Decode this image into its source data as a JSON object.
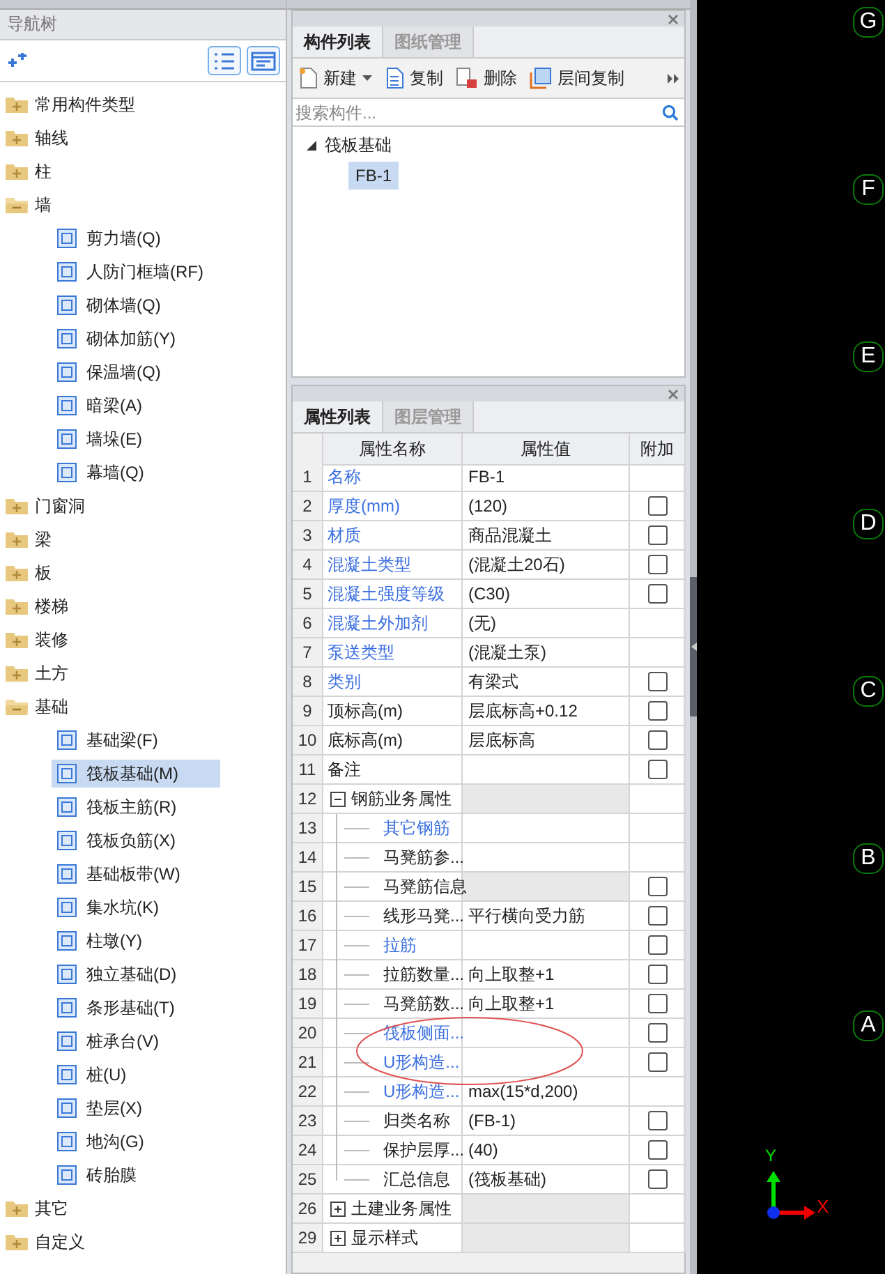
{
  "nav": {
    "title": "导航树",
    "tree": [
      {
        "label": "常用构件类型",
        "expanded": false
      },
      {
        "label": "轴线",
        "expanded": false
      },
      {
        "label": "柱",
        "expanded": false
      },
      {
        "label": "墙",
        "expanded": true,
        "children": [
          {
            "label": "剪力墙(Q)",
            "selected": false
          },
          {
            "label": "人防门框墙(RF)",
            "selected": false
          },
          {
            "label": "砌体墙(Q)",
            "selected": false
          },
          {
            "label": "砌体加筋(Y)",
            "selected": false
          },
          {
            "label": "保温墙(Q)",
            "selected": false
          },
          {
            "label": "暗梁(A)",
            "selected": false
          },
          {
            "label": "墙垛(E)",
            "selected": false
          },
          {
            "label": "幕墙(Q)",
            "selected": false
          }
        ]
      },
      {
        "label": "门窗洞",
        "expanded": false
      },
      {
        "label": "梁",
        "expanded": false
      },
      {
        "label": "板",
        "expanded": false
      },
      {
        "label": "楼梯",
        "expanded": false
      },
      {
        "label": "装修",
        "expanded": false
      },
      {
        "label": "土方",
        "expanded": false
      },
      {
        "label": "基础",
        "expanded": true,
        "children": [
          {
            "label": "基础梁(F)",
            "selected": false
          },
          {
            "label": "筏板基础(M)",
            "selected": true
          },
          {
            "label": "筏板主筋(R)",
            "selected": false
          },
          {
            "label": "筏板负筋(X)",
            "selected": false
          },
          {
            "label": "基础板带(W)",
            "selected": false
          },
          {
            "label": "集水坑(K)",
            "selected": false
          },
          {
            "label": "柱墩(Y)",
            "selected": false
          },
          {
            "label": "独立基础(D)",
            "selected": false
          },
          {
            "label": "条形基础(T)",
            "selected": false
          },
          {
            "label": "桩承台(V)",
            "selected": false
          },
          {
            "label": "桩(U)",
            "selected": false
          },
          {
            "label": "垫层(X)",
            "selected": false
          },
          {
            "label": "地沟(G)",
            "selected": false
          },
          {
            "label": "砖胎膜",
            "selected": false
          }
        ]
      },
      {
        "label": "其它",
        "expanded": false
      },
      {
        "label": "自定义",
        "expanded": false
      }
    ]
  },
  "component_panel": {
    "tabs": [
      {
        "label": "构件列表",
        "selected": true
      },
      {
        "label": "图纸管理",
        "selected": false
      }
    ],
    "toolbar": [
      {
        "label": "新建",
        "kind": "new"
      },
      {
        "label": "复制",
        "kind": "copy"
      },
      {
        "label": "删除",
        "kind": "delete"
      },
      {
        "label": "层间复制",
        "kind": "floorcopy"
      }
    ],
    "search": {
      "placeholder": "搜索构件..."
    },
    "tree": [
      {
        "label": "筏板基础",
        "expanded": true,
        "children": [
          {
            "label": "FB-1",
            "selected": true
          }
        ]
      }
    ]
  },
  "property_panel": {
    "tabs": [
      {
        "label": "属性列表",
        "selected": true
      },
      {
        "label": "图层管理",
        "selected": false
      }
    ],
    "columns": [
      "属性名称",
      "属性值",
      "附加"
    ],
    "rows": [
      {
        "num": "1",
        "name": "名称",
        "value": "FB-1",
        "public": true
      },
      {
        "num": "2",
        "name": "厚度(mm)",
        "value": "(120)",
        "public": true,
        "checked": false
      },
      {
        "num": "3",
        "name": "材质",
        "value": "商品混凝土",
        "public": true,
        "checked": false
      },
      {
        "num": "4",
        "name": "混凝土类型",
        "value": "(混凝土20石)",
        "public": true,
        "checked": false
      },
      {
        "num": "5",
        "name": "混凝土强度等级",
        "value": "(C30)",
        "public": true,
        "checked": false
      },
      {
        "num": "6",
        "name": "混凝土外加剂",
        "value": "(无)",
        "public": true
      },
      {
        "num": "7",
        "name": "泵送类型",
        "value": "(混凝土泵)",
        "public": true
      },
      {
        "num": "8",
        "name": "类别",
        "value": "有梁式",
        "public": true,
        "checked": false
      },
      {
        "num": "9",
        "name": "顶标高(m)",
        "value": "层底标高+0.12",
        "public": false,
        "checked": false
      },
      {
        "num": "10",
        "name": "底标高(m)",
        "value": "层底标高",
        "public": false,
        "checked": false
      },
      {
        "num": "11",
        "name": "备注",
        "public": false,
        "checked": false
      },
      {
        "num": "12",
        "name": "钢筋业务属性",
        "kind": "group",
        "expanded": true,
        "children": [
          {
            "num": "13",
            "name": "其它钢筋",
            "public": true
          },
          {
            "num": "14",
            "name": "马凳筋参...",
            "public": false
          },
          {
            "num": "15",
            "name": "马凳筋信息",
            "public": false,
            "value_disabled": true,
            "checked": false
          },
          {
            "num": "16",
            "name": "线形马凳...",
            "value": "平行横向受力筋",
            "public": false,
            "checked": false
          },
          {
            "num": "17",
            "name": "拉筋",
            "public": true,
            "checked": false
          },
          {
            "num": "18",
            "name": "拉筋数量...",
            "value": "向上取整+1",
            "public": false,
            "checked": false
          },
          {
            "num": "19",
            "name": "马凳筋数...",
            "value": "向上取整+1",
            "public": false,
            "checked": false
          },
          {
            "num": "20",
            "name": "筏板侧面...",
            "public": true,
            "checked": false
          },
          {
            "num": "21",
            "name": "U形构造...",
            "public": true,
            "checked": false
          },
          {
            "num": "22",
            "name": "U形构造...",
            "value": "max(15*d,200)",
            "public": true
          },
          {
            "num": "23",
            "name": "归类名称",
            "value": "(FB-1)",
            "public": false,
            "checked": false
          },
          {
            "num": "24",
            "name": "保护层厚...",
            "value": "(40)",
            "public": false,
            "checked": false
          },
          {
            "num": "25",
            "name": "汇总信息",
            "value": "(筏板基础)",
            "public": false,
            "checked": false
          }
        ]
      },
      {
        "num": "26",
        "name": "土建业务属性",
        "kind": "group",
        "expanded": false
      },
      {
        "num": "29",
        "name": "显示样式",
        "kind": "group",
        "expanded": false
      }
    ]
  },
  "canvas": {
    "axis_labels": [
      "G",
      "F",
      "E",
      "D",
      "C",
      "B",
      "A"
    ],
    "x_axis": "X",
    "y_axis": "Y"
  }
}
